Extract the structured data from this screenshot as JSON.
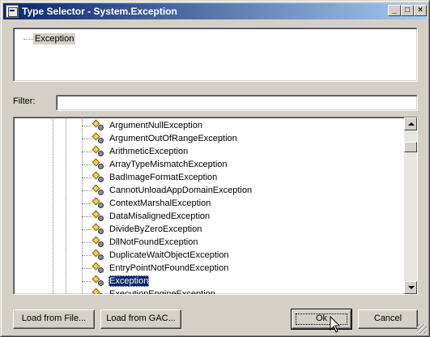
{
  "window": {
    "title": "Type Selector - System.Exception",
    "controls": {
      "minimize": "_",
      "maximize": "□",
      "close": "×"
    }
  },
  "top_tree": {
    "root_label": "Exception"
  },
  "filter": {
    "label": "Filter:",
    "value": "",
    "placeholder": ""
  },
  "type_list": {
    "items": [
      {
        "label": "ArgumentNullException",
        "icon": "class-icon",
        "selected": false
      },
      {
        "label": "ArgumentOutOfRangeException",
        "icon": "class-icon",
        "selected": false
      },
      {
        "label": "ArithmeticException",
        "icon": "class-icon",
        "selected": false
      },
      {
        "label": "ArrayTypeMismatchException",
        "icon": "class-icon",
        "selected": false
      },
      {
        "label": "BadImageFormatException",
        "icon": "class-icon",
        "selected": false
      },
      {
        "label": "CannotUnloadAppDomainException",
        "icon": "class-icon",
        "selected": false
      },
      {
        "label": "ContextMarshalException",
        "icon": "class-icon",
        "selected": false
      },
      {
        "label": "DataMisalignedException",
        "icon": "class-icon",
        "selected": false
      },
      {
        "label": "DivideByZeroException",
        "icon": "class-icon",
        "selected": false
      },
      {
        "label": "DllNotFoundException",
        "icon": "class-icon",
        "selected": false
      },
      {
        "label": "DuplicateWaitObjectException",
        "icon": "class-icon",
        "selected": false
      },
      {
        "label": "EntryPointNotFoundException",
        "icon": "class-icon",
        "selected": false
      },
      {
        "label": "Exception",
        "icon": "class-icon",
        "selected": true
      },
      {
        "label": "ExecutionEngineException",
        "icon": "class-icon",
        "selected": false
      }
    ],
    "selection_color": "#0a246a"
  },
  "buttons": {
    "load_from_file": "Load from File...",
    "load_from_gac": "Load from GAC...",
    "ok": "Ok",
    "cancel": "Cancel"
  },
  "colors": {
    "titlebar_start": "#0a246a",
    "titlebar_end": "#a6caf0",
    "face": "#d4d0c8"
  }
}
